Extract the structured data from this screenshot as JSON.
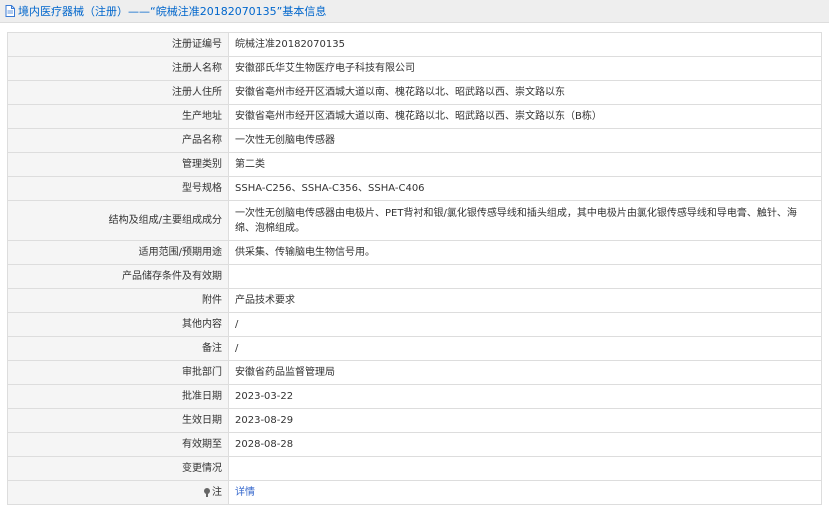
{
  "header": {
    "title": "境内医疗器械（注册）——“皖械注准20182070135”基本信息",
    "icon": "document-icon"
  },
  "rows": [
    {
      "label": "注册证编号",
      "value": "皖械注准20182070135"
    },
    {
      "label": "注册人名称",
      "value": "安徽邵氏华艾生物医疗电子科技有限公司"
    },
    {
      "label": "注册人住所",
      "value": "安徽省亳州市经开区酒城大道以南、槐花路以北、昭武路以西、崇文路以东"
    },
    {
      "label": "生产地址",
      "value": "安徽省亳州市经开区酒城大道以南、槐花路以北、昭武路以西、崇文路以东（B栋）"
    },
    {
      "label": "产品名称",
      "value": "一次性无创脑电传感器"
    },
    {
      "label": "管理类别",
      "value": "第二类"
    },
    {
      "label": "型号规格",
      "value": "SSHA-C256、SSHA-C356、SSHA-C406"
    },
    {
      "label": "结构及组成/主要组成成分",
      "value": "一次性无创脑电传感器由电极片、PET背衬和银/氯化银传感导线和插头组成，其中电极片由氯化银传感导线和导电膏、触针、海绵、泡棉组成。"
    },
    {
      "label": "适用范围/预期用途",
      "value": "供采集、传输脑电生物信号用。"
    },
    {
      "label": "产品储存条件及有效期",
      "value": ""
    },
    {
      "label": "附件",
      "value": "产品技术要求"
    },
    {
      "label": "其他内容",
      "value": "/"
    },
    {
      "label": "备注",
      "value": "/"
    },
    {
      "label": "审批部门",
      "value": "安徽省药品监督管理局"
    },
    {
      "label": "批准日期",
      "value": "2023-03-22"
    },
    {
      "label": "生效日期",
      "value": "2023-08-29"
    },
    {
      "label": "有效期至",
      "value": "2028-08-28"
    },
    {
      "label": "变更情况",
      "value": ""
    }
  ],
  "note_row": {
    "label": "注",
    "link": "详情",
    "icon": "pin-icon"
  }
}
